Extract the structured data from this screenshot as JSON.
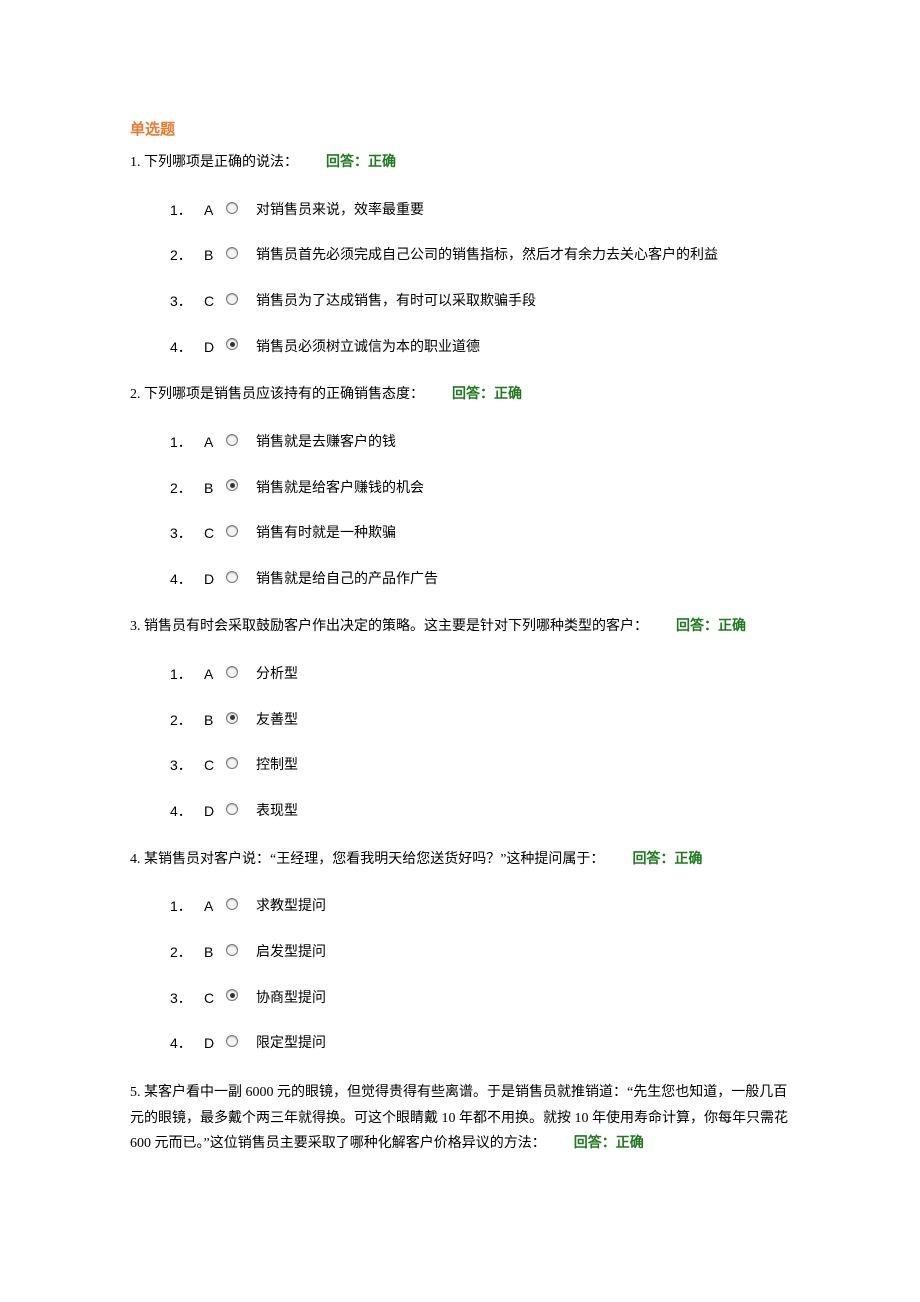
{
  "section_title": "单选题",
  "answer_label": "回答：正确",
  "questions": [
    {
      "num": "1.",
      "text": "下列哪项是正确的说法：",
      "selected": 3,
      "options": [
        "对销售员来说，效率最重要",
        "销售员首先必须完成自己公司的销售指标，然后才有余力去关心客户的利益",
        "销售员为了达成销售，有时可以采取欺骗手段",
        "销售员必须树立诚信为本的职业道德"
      ]
    },
    {
      "num": "2.",
      "text": "下列哪项是销售员应该持有的正确销售态度：",
      "selected": 1,
      "options": [
        "销售就是去赚客户的钱",
        "销售就是给客户赚钱的机会",
        "销售有时就是一种欺骗",
        "销售就是给自己的产品作广告"
      ]
    },
    {
      "num": "3.",
      "text": "销售员有时会采取鼓励客户作出决定的策略。这主要是针对下列哪种类型的客户：",
      "selected": 1,
      "options": [
        "分析型",
        "友善型",
        "控制型",
        "表现型"
      ]
    },
    {
      "num": "4.",
      "text": "某销售员对客户说：“王经理，您看我明天给您送货好吗？”这种提问属于：",
      "selected": 2,
      "options": [
        "求教型提问",
        "启发型提问",
        "协商型提问",
        "限定型提问"
      ]
    },
    {
      "num": "5.",
      "text": "某客户看中一副 6000 元的眼镜，但觉得贵得有些离谱。于是销售员就推销道：“先生您也知道，一般几百元的眼镜，最多戴个两三年就得换。可这个眼睛戴 10 年都不用换。就按 10 年使用寿命计算，你每年只需花 600 元而已。”这位销售员主要采取了哪种化解客户价格异议的方法：",
      "selected": -1,
      "options": []
    }
  ],
  "letters": [
    "A",
    "B",
    "C",
    "D"
  ],
  "indices": [
    "1．",
    "2．",
    "3．",
    "4．"
  ]
}
